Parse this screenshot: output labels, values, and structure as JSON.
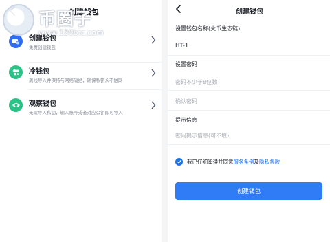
{
  "left": {
    "title": "创建钱包",
    "watermark": {
      "title": "币圈子",
      "url": "www.120btc.com"
    },
    "items": [
      {
        "name": "创建钱包",
        "desc": "免费创建钱包",
        "icon": "wallet-add-icon",
        "color": "#2f6cf0"
      },
      {
        "name": "冷钱包",
        "desc": "离线导入并保持与网络隔绝，确保私钥永不触网",
        "icon": "cold-wallet-icon",
        "color": "#2bc287"
      },
      {
        "name": "观察钱包",
        "desc": "无需导入私钥，输入账号或者对应公钥即可导入",
        "icon": "eye-icon",
        "color": "#2bc287"
      }
    ]
  },
  "right": {
    "title": "创建钱包",
    "wallet_name_label": "设置钱包名称(火币生态链)",
    "wallet_name_value": "HT-1",
    "password_label": "设置密码",
    "password_placeholder": "密码不少于8位数",
    "confirm_placeholder": "确认密码",
    "hint_label": "提示信息",
    "hint_placeholder": "密码提示信息(可不填)",
    "agree_prefix": "我已仔细阅读并同意",
    "terms_link": "服务条例",
    "agree_and": "及",
    "privacy_link": "隐私条款",
    "create_button": "创建钱包"
  },
  "colors": {
    "accent": "#2f7cf6",
    "green": "#2bc287",
    "link": "#1a73e8"
  }
}
